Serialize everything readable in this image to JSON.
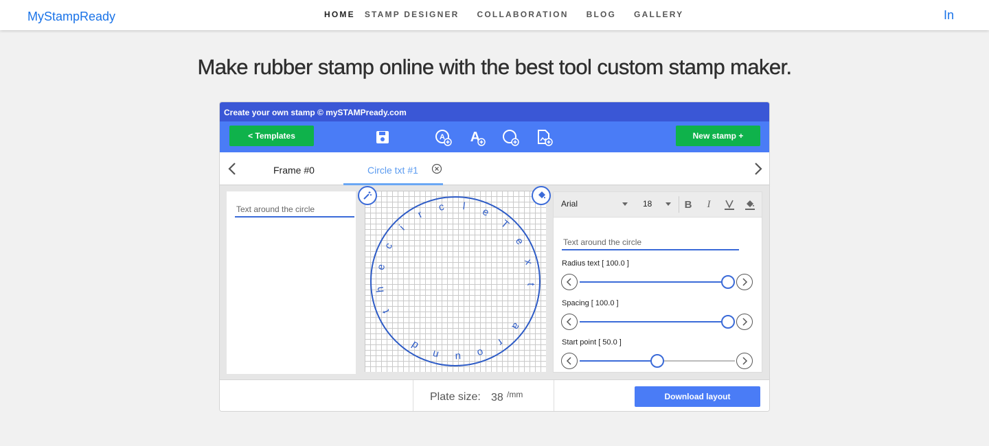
{
  "topbar": {
    "brand": "MyStampReady",
    "nav": [
      "HOME",
      "STAMP DESIGNER",
      "COLLABORATION",
      "BLOG",
      "GALLERY"
    ],
    "linkedin": "In"
  },
  "headline": "Make rubber stamp online with the best tool custom stamp maker.",
  "app": {
    "title": "Create your own stamp © mySTAMPready.com",
    "templates_label": "<  Templates",
    "new_stamp_label": "New stamp +",
    "tools": [
      "save-icon",
      "add-circle-text-icon",
      "add-text-icon",
      "add-circle-icon",
      "add-image-icon"
    ],
    "tabs": [
      {
        "label": "Frame #0",
        "active": false
      },
      {
        "label": "Circle txt #1",
        "active": true
      }
    ],
    "left_input_placeholder": "Text around the circle",
    "canvas": {
      "circle_text": "circleText around the",
      "stroke_color": "#2d5bc6"
    },
    "editor": {
      "font": "Arial",
      "size": "18",
      "format_buttons": [
        "bold-icon",
        "italic-icon",
        "text-color-icon",
        "fill-color-icon"
      ],
      "text_placeholder": "Text around the circle",
      "sliders": [
        {
          "label": "Radius text [ 100.0 ]",
          "fraction": 0.955
        },
        {
          "label": "Spacing [ 100.0 ]",
          "fraction": 0.955
        },
        {
          "label": "Start point [ 50.0 ]",
          "fraction": 0.5
        }
      ]
    },
    "footer": {
      "plate_label": "Plate size:",
      "plate_value": "38",
      "plate_unit": "/mm",
      "download_label": "Download layout"
    }
  },
  "colors": {
    "brand": "#1a73e8",
    "title_bar": "#3a57d6",
    "toolbar": "#4a7cf6",
    "green": "#0fb24b"
  }
}
